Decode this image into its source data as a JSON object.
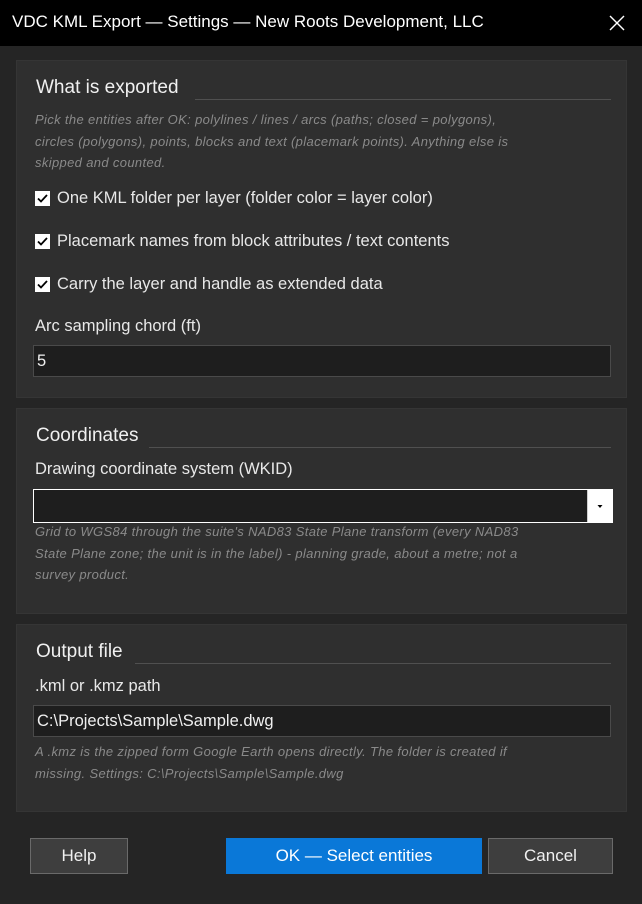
{
  "window": {
    "title": "VDC KML Export — Settings — New Roots Development, LLC",
    "close_icon": "close-icon"
  },
  "export_section": {
    "title": "What is exported",
    "hint_lines": [
      "Pick the entities after OK: polylines / lines / arcs (paths; closed = polygons),",
      "circles (polygons), points, blocks and text (placemark points). Anything else is",
      "skipped and counted."
    ],
    "options": [
      {
        "label": "One KML folder per layer (folder color = layer color)",
        "checked": true
      },
      {
        "label": "Placemark names from block attributes / text contents",
        "checked": true
      },
      {
        "label": "Carry the layer and handle as extended data",
        "checked": true
      }
    ],
    "arc_label": "Arc sampling chord (ft)",
    "arc_value": "5"
  },
  "coords_section": {
    "title": "Coordinates",
    "wkid_label": "Drawing coordinate system (WKID)",
    "wkid_value": "",
    "hint_lines": [
      "Grid to WGS84 through the suite's NAD83 State Plane transform (every NAD83",
      "State Plane zone; the unit is in the label) - planning grade, about a metre; not a",
      "survey product."
    ]
  },
  "output_section": {
    "title": "Output file",
    "path_label": ".kml or .kmz path",
    "path_value": "C:\\Projects\\Sample\\Sample.dwg",
    "hint_lines": [
      "A .kmz is the zipped form Google Earth opens directly. The folder is created if",
      "missing.  Settings:  C:\\Projects\\Sample\\Sample.dwg"
    ]
  },
  "buttons": {
    "help": "Help",
    "ok": "OK — Select entities",
    "cancel": "Cancel"
  },
  "colors": {
    "accent": "#0a78d8",
    "background": "#252525",
    "panel": "#2f2f2f"
  }
}
